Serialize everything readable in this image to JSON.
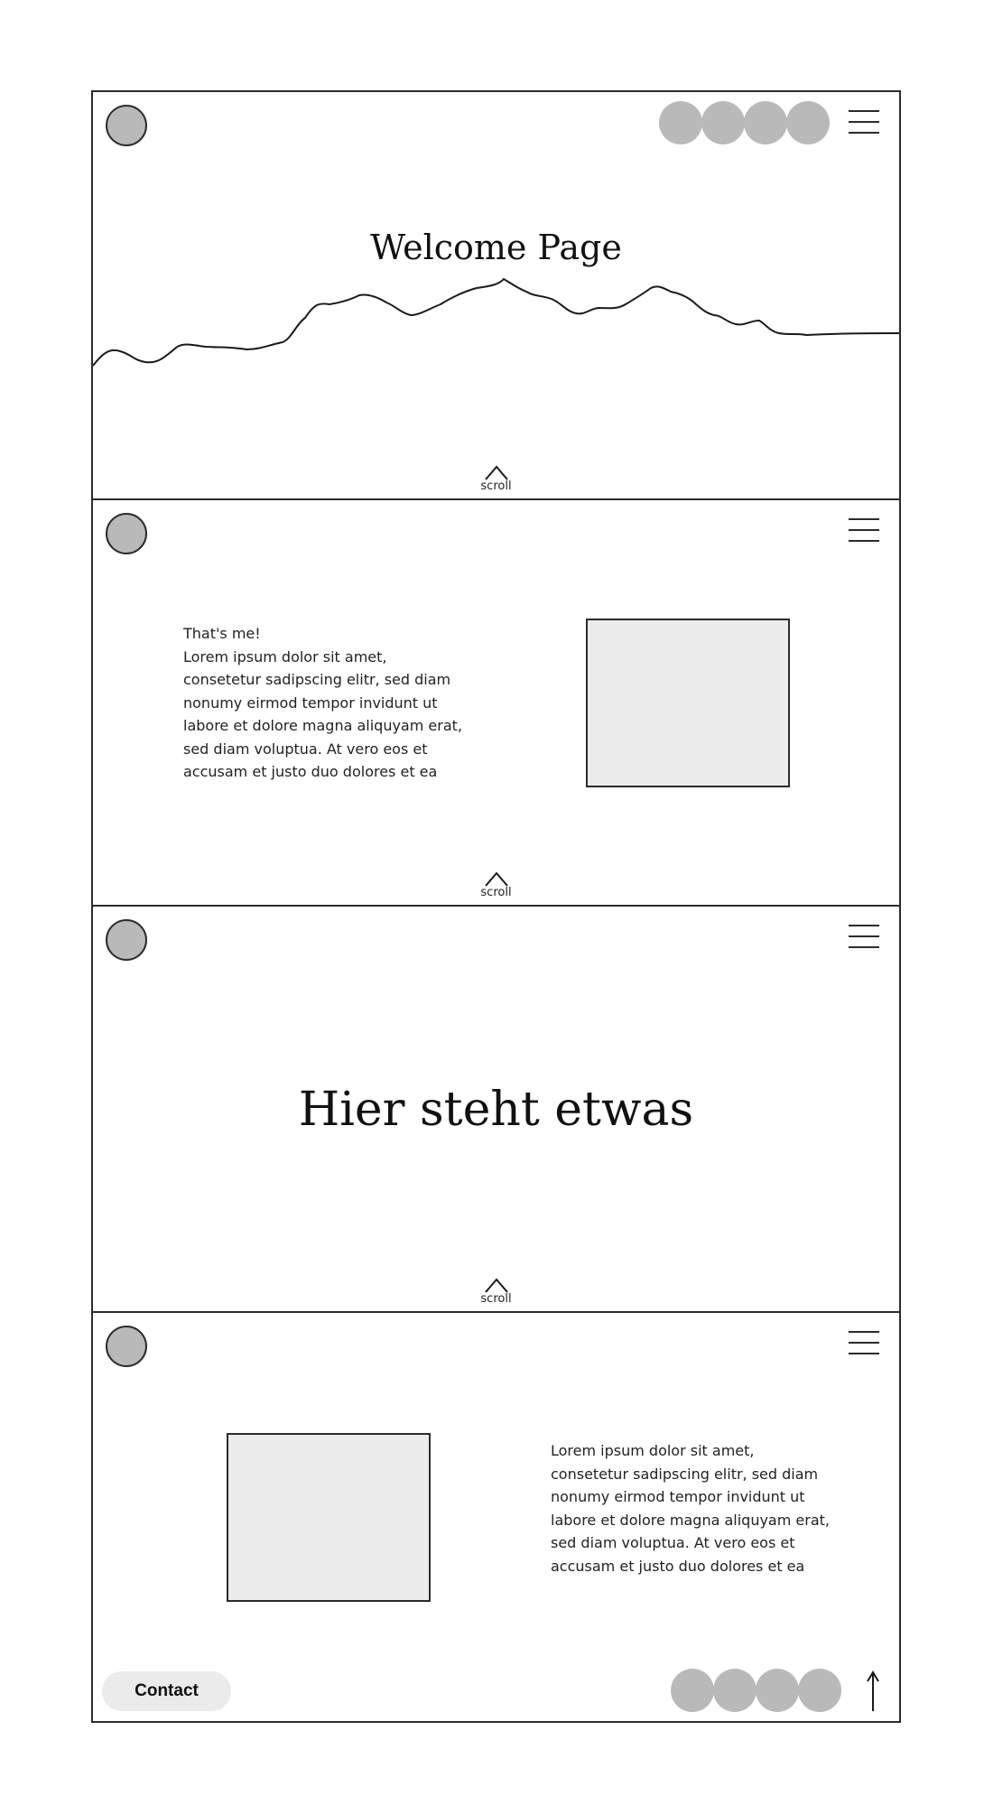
{
  "sections": {
    "welcome": {
      "title": "Welcome Page",
      "scroll_label": "scroll"
    },
    "about": {
      "heading": "That's me!",
      "body_lines": [
        "Lorem ipsum dolor sit amet,",
        "consetetur sadipscing elitr, sed diam",
        "nonumy eirmod tempor invidunt ut",
        "labore et dolore magna aliquyam erat,",
        "sed diam voluptua. At vero eos et",
        "accusam et justo duo dolores et ea"
      ],
      "scroll_label": "scroll"
    },
    "statement": {
      "title": "Hier steht etwas",
      "scroll_label": "scroll"
    },
    "footer_section": {
      "body_lines": [
        "Lorem ipsum dolor sit amet,",
        "consetetur sadipscing elitr, sed diam",
        "nonumy eirmod tempor invidunt ut",
        "labore et dolore magna aliquyam erat,",
        "sed diam voluptua. At vero eos et",
        "accusam et justo duo dolores et ea"
      ],
      "contact_label": "Contact"
    }
  },
  "icons": {
    "logo": "logo-circle",
    "menu": "hamburger-icon",
    "social": [
      "social-icon-1",
      "social-icon-2",
      "social-icon-3",
      "social-icon-4"
    ],
    "scroll": "chevron-up-icon",
    "back_to_top": "arrow-up-icon"
  },
  "colors": {
    "placeholder_gray": "#b9b9b9",
    "image_fill": "#ebebeb",
    "border": "#2b2b2b"
  }
}
